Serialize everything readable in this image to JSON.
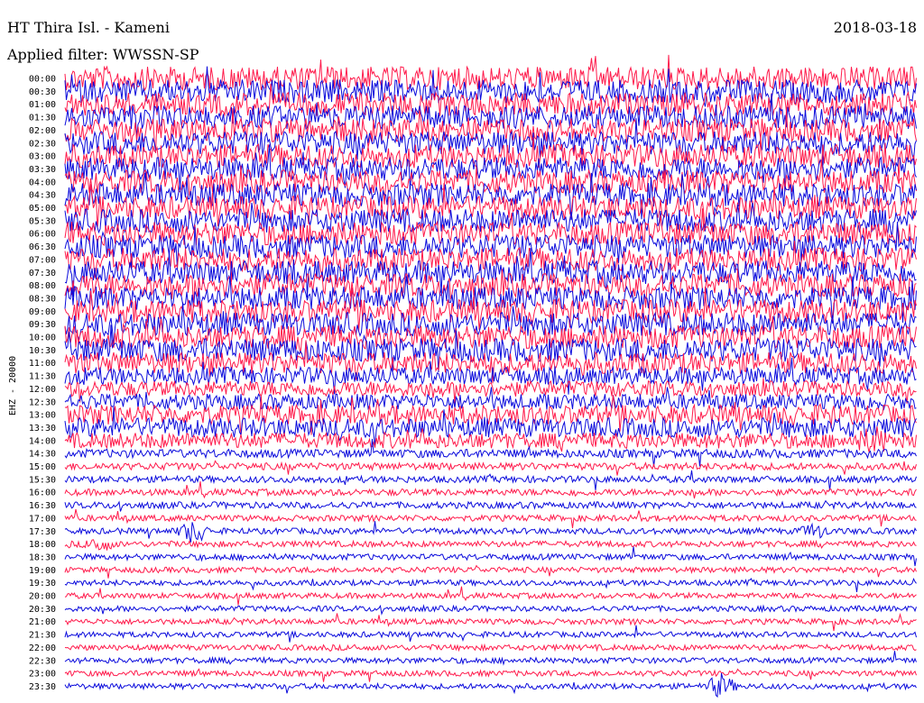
{
  "header": {
    "station": "HT Thira Isl. - Kameni",
    "date": "2018-03-18",
    "filter": "Applied filter: WWSSN-SP"
  },
  "channel_label": "EHZ - 20000",
  "colors": {
    "even_trace": "#ff1a4b",
    "odd_trace": "#0a0adc",
    "text": "#000000",
    "background": "#ffffff"
  },
  "chart_data": {
    "type": "line",
    "title": "HT Thira Isl. - Kameni",
    "subtitle": "Applied filter: WWSSN-SP",
    "ylabel": "EHZ - 20000",
    "xlabel": "",
    "tick_labels": [
      "00:00",
      "00:30",
      "01:00",
      "01:30",
      "02:00",
      "02:30",
      "03:00",
      "03:30",
      "04:00",
      "04:30",
      "05:00",
      "05:30",
      "06:00",
      "06:30",
      "07:00",
      "07:30",
      "08:00",
      "08:30",
      "09:00",
      "09:30",
      "10:00",
      "10:30",
      "11:00",
      "11:30",
      "12:00",
      "12:30",
      "13:00",
      "13:30",
      "14:00",
      "14:30",
      "15:00",
      "15:30",
      "16:00",
      "16:30",
      "17:00",
      "17:30",
      "18:00",
      "18:30",
      "19:00",
      "19:30",
      "20:00",
      "20:30",
      "21:00",
      "21:30",
      "22:00",
      "22:30",
      "23:00",
      "23:30"
    ],
    "trace_colors": [
      "#ff1a4b",
      "#0a0adc"
    ],
    "relative_noise_amplitude": [
      1.0,
      1.0,
      1.0,
      1.0,
      1.0,
      1.0,
      1.0,
      1.0,
      1.0,
      1.0,
      1.0,
      1.0,
      1.0,
      1.0,
      1.0,
      1.0,
      1.0,
      1.0,
      1.0,
      1.0,
      1.0,
      1.0,
      0.9,
      0.7,
      0.6,
      0.6,
      0.8,
      0.8,
      0.6,
      0.25,
      0.18,
      0.15,
      0.15,
      0.15,
      0.12,
      0.12,
      0.12,
      0.12,
      0.1,
      0.1,
      0.1,
      0.1,
      0.1,
      0.1,
      0.1,
      0.1,
      0.1,
      0.1
    ],
    "events": [
      {
        "time": "17:30",
        "x_fraction": 0.15,
        "amplitude": 0.9
      },
      {
        "time": "23:30",
        "x_fraction": 0.77,
        "amplitude": 1.0
      },
      {
        "time": "14:00",
        "x_fraction": 0.95,
        "amplitude": 0.8
      },
      {
        "time": "18:00",
        "x_fraction": 0.04,
        "amplitude": 0.6
      },
      {
        "time": "17:30",
        "x_fraction": 0.88,
        "amplitude": 0.6
      }
    ],
    "grid": false,
    "legend": "none"
  }
}
